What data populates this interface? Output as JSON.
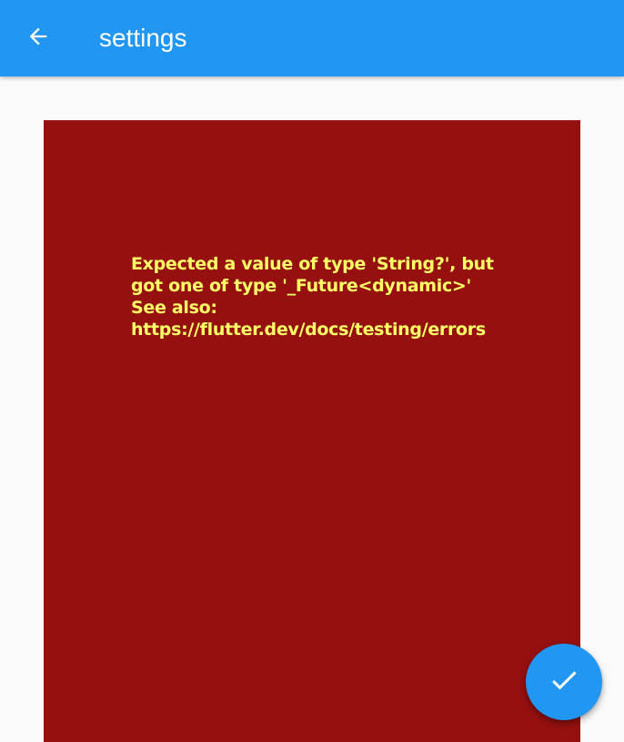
{
  "appbar": {
    "title": "settings",
    "back_icon": "arrow-back-icon",
    "color": "#2196f3"
  },
  "error": {
    "message": "Expected a value of type 'String?', but got one of type '_Future<dynamic>'\nSee also: https://flutter.dev/docs/testing/errors",
    "background": "#961010",
    "text_color": "#ffff66"
  },
  "fab": {
    "icon": "check-icon",
    "color": "#2196f3"
  }
}
